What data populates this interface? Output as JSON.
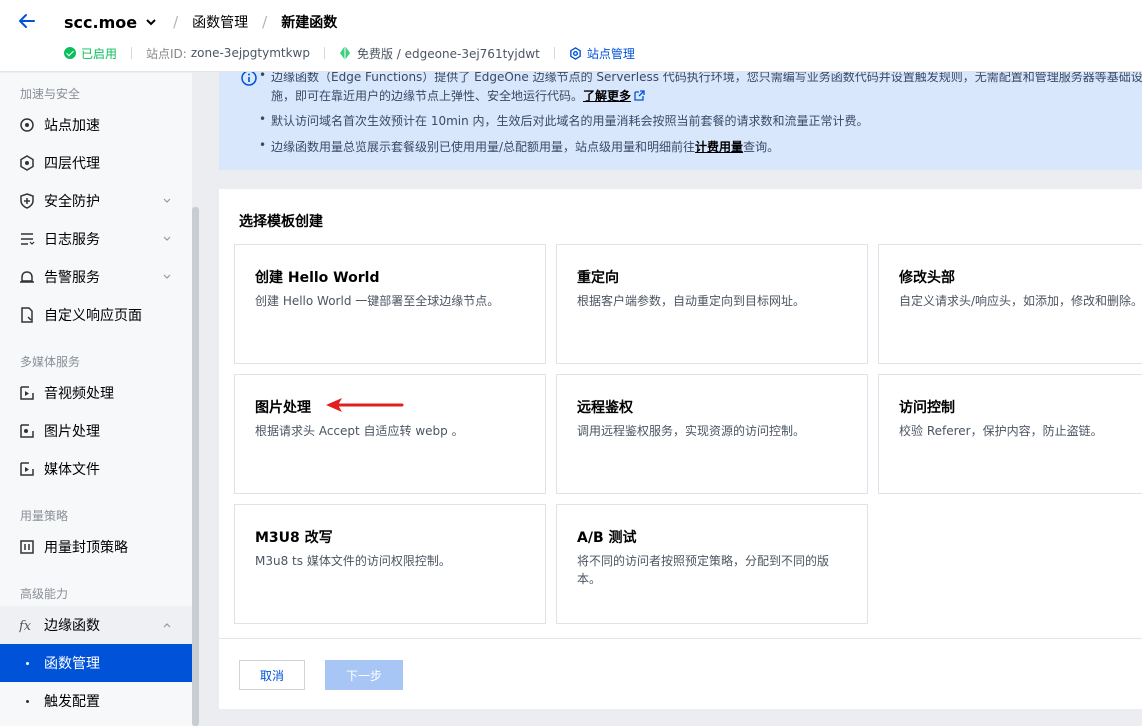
{
  "header": {
    "site": "scc.moe",
    "crumb_function_mgmt": "函数管理",
    "crumb_current": "新建函数",
    "status": "已启用",
    "site_id_label": "站点ID:",
    "site_id": "zone-3ejpgtymtkwp",
    "plan": "免费版 / edgeone-3ej761tyjdwt",
    "site_mgmt": "站点管理"
  },
  "sidebar": {
    "group1": "加速与安全",
    "items1": [
      "站点加速",
      "四层代理",
      "安全防护",
      "日志服务",
      "告警服务",
      "自定义响应页面"
    ],
    "group2": "多媒体服务",
    "items2": [
      "音视频处理",
      "图片处理",
      "媒体文件"
    ],
    "group3": "用量策略",
    "items3": [
      "用量封顶策略"
    ],
    "group4": "高级能力",
    "edge_functions": "边缘函数",
    "sub_function_mgmt": "函数管理",
    "sub_trigger_config": "触发配置"
  },
  "notice": {
    "line1": "边缘函数（Edge Functions）提供了 EdgeOne 边缘节点的 Serverless 代码执行环境，您只需编写业务函数代码并设置触发规则，无需配置和管理服务器等基础设",
    "line1b_pre": "施，即可在靠近用户的边缘节点上弹性、安全地运行代码。",
    "line1b_link": "了解更多",
    "line2": "默认访问域名首次生效预计在 10min 内，生效后对此域名的用量消耗会按照当前套餐的请求数和流量正常计费。",
    "line3_pre": "边缘函数用量总览展示套餐级别已使用用量/总配额用量，站点级用量和明细前往",
    "line3_link": "计费用量",
    "line3_post": "查询。"
  },
  "panel": {
    "title": "选择模板创建",
    "cards": [
      {
        "title": "创建 Hello World",
        "desc": "创建 Hello World 一键部署至全球边缘节点。"
      },
      {
        "title": "重定向",
        "desc": "根据客户端参数，自动重定向到目标网址。"
      },
      {
        "title": "修改头部",
        "desc": "自定义请求头/响应头，如添加，修改和删除。"
      },
      {
        "title": "图片处理",
        "desc": "根据请求头 Accept 自适应转 webp 。"
      },
      {
        "title": "远程鉴权",
        "desc": "调用远程鉴权服务，实现资源的访问控制。"
      },
      {
        "title": "访问控制",
        "desc": "校验 Referer，保护内容，防止盗链。"
      },
      {
        "title": "M3U8 改写",
        "desc": "M3u8 ts 媒体文件的访问权限控制。"
      },
      {
        "title": "A/B 测试",
        "desc": "将不同的访问者按照预定策略，分配到不同的版本。"
      }
    ]
  },
  "buttons": {
    "cancel": "取消",
    "next": "下一步"
  },
  "colors": {
    "accent": "#0052d9",
    "status_green": "#0abf5b",
    "arrow_red": "#e02020"
  }
}
